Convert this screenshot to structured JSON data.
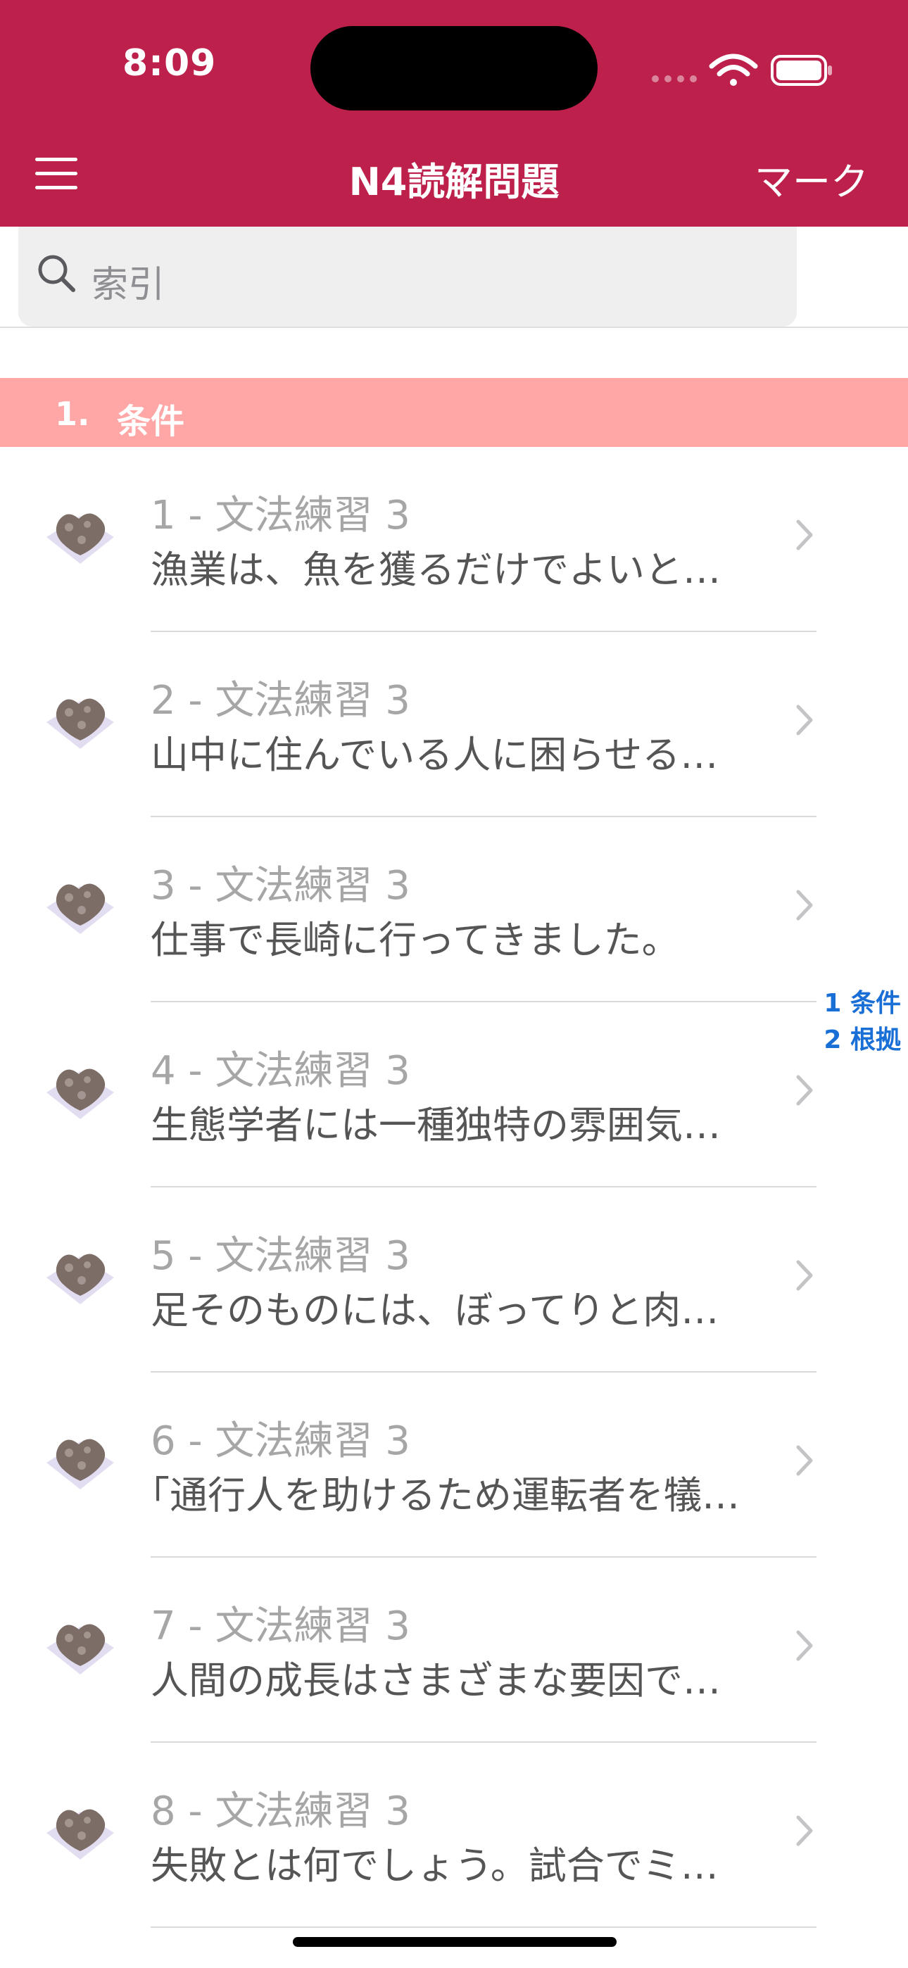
{
  "status_bar": {
    "time": "8:09"
  },
  "nav": {
    "title": "N4読解問題",
    "mark_label": "マーク"
  },
  "search": {
    "placeholder": "索引"
  },
  "section": {
    "number": "1.",
    "label": "条件"
  },
  "rows": [
    {
      "title": "1 - 文法練習 3",
      "subtitle": "漁業は、魚を獲るだけでよいと…"
    },
    {
      "title": "2 - 文法練習 3",
      "subtitle": "山中に住んでいる人に困らせる…"
    },
    {
      "title": "3 - 文法練習 3",
      "subtitle": "仕事で長崎に行ってきました。"
    },
    {
      "title": "4 - 文法練習 3",
      "subtitle": "生態学者には一種独特の雰囲気…"
    },
    {
      "title": "5 - 文法練習 3",
      "subtitle": "足そのものには、ぼってりと肉…"
    },
    {
      "title": "6 - 文法練習 3",
      "subtitle": "｢通行人を助けるため運転者を犠…"
    },
    {
      "title": "7 - 文法練習 3",
      "subtitle": "人間の成長はさまざまな要因で…"
    },
    {
      "title": "8 - 文法練習 3",
      "subtitle": "失敗とは何でしょう。試合でミ…"
    }
  ],
  "index_bar": [
    "1 条件",
    "2 根拠"
  ],
  "colors": {
    "header": "#bc204b",
    "section": "#ffa6a6",
    "index": "#1a6fd6"
  },
  "icons": [
    "menu-icon",
    "search-icon",
    "chevron-right-icon",
    "wifi-icon",
    "battery-icon",
    "signal-icon",
    "thumbnail-image"
  ]
}
